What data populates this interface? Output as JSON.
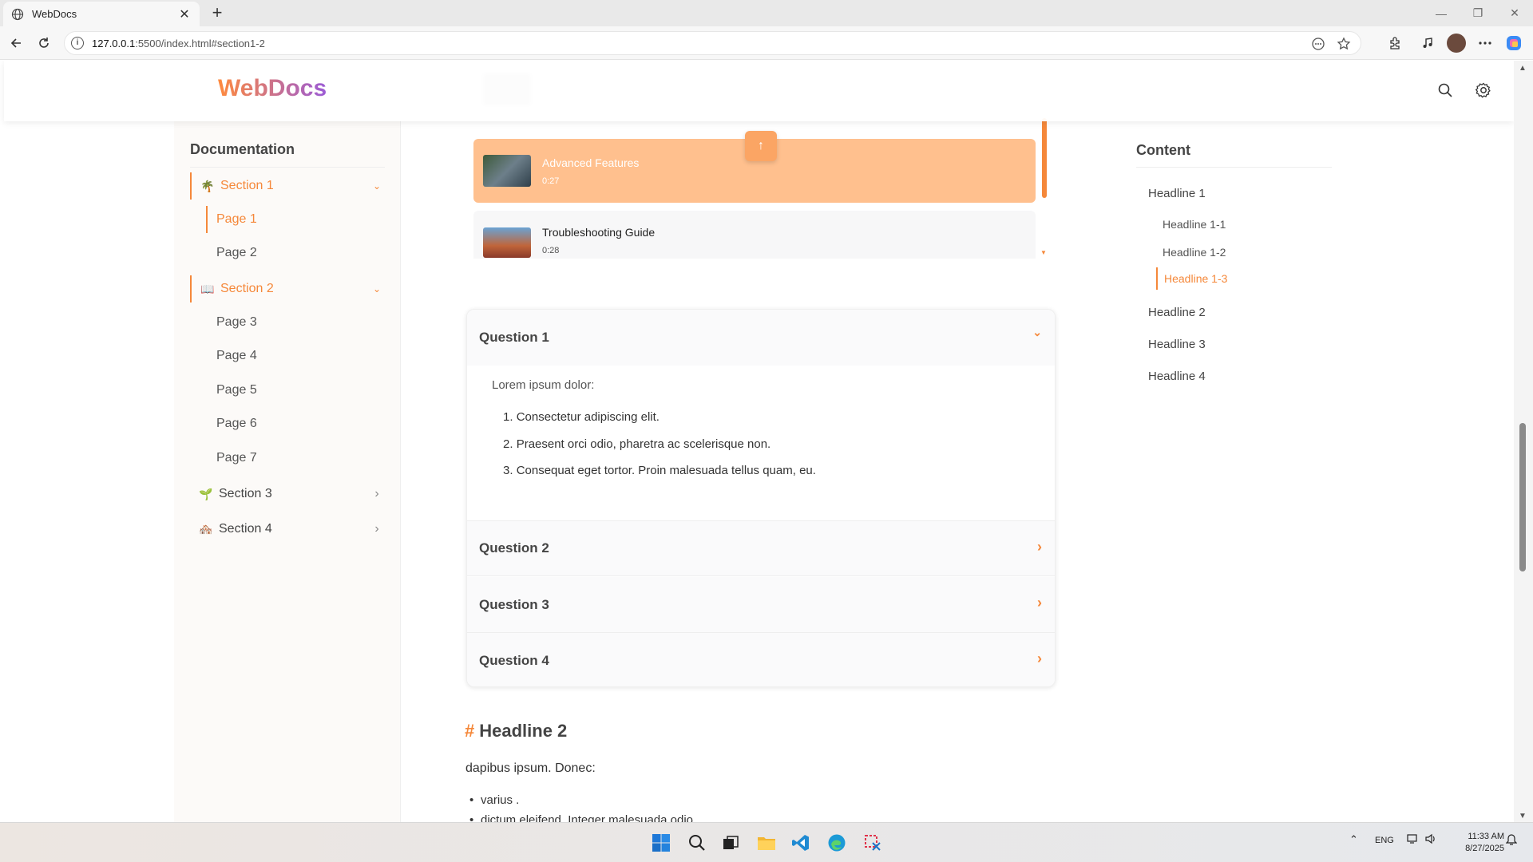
{
  "browser": {
    "tab_title": "WebDocs",
    "new_tab": "+",
    "url_host": "127.0.0.1",
    "url_rest": ":5500/index.html#section1-2",
    "minimize": "—",
    "restore": "❐",
    "close": "✕"
  },
  "site": {
    "logo": "WebDocs",
    "colors": {
      "accent": "#f5883a",
      "active_bg": "#ffc08e",
      "logo_from": "#ff8a3d",
      "logo_to": "#9b5bd6"
    }
  },
  "sidebar": {
    "title": "Documentation",
    "sections": [
      {
        "emoji": "🌴",
        "label": "Section 1",
        "chevron": "⌄"
      },
      {
        "emoji": "📖",
        "label": "Section 2",
        "chevron": "⌄"
      },
      {
        "emoji": "🌱",
        "label": "Section 3",
        "chevron": "›"
      },
      {
        "emoji": "🏘️",
        "label": "Section 4",
        "chevron": "›"
      }
    ],
    "pages": [
      "Page 1",
      "Page 2",
      "Page 3",
      "Page 4",
      "Page 5",
      "Page 6",
      "Page 7"
    ]
  },
  "playlist": {
    "items": [
      {
        "title": "Advanced Features",
        "duration": "0:27"
      },
      {
        "title": "Troubleshooting Guide",
        "duration": "0:28"
      }
    ],
    "to_top": "↑"
  },
  "faq": {
    "questions": [
      "Question 1",
      "Question 2",
      "Question 3",
      "Question 4"
    ],
    "open_chevron": "⌄",
    "closed_chevron": "›",
    "intro": "Lorem ipsum dolor:",
    "list": [
      "Consectetur adipiscing elit.",
      "Praesent orci odio, pharetra ac scelerisque non.",
      "Consequat eget tortor. Proin malesuada tellus quam, eu."
    ],
    "list_numbers": [
      "1.",
      "2.",
      "3."
    ]
  },
  "article": {
    "hash": "#",
    "headline": "Headline 2",
    "paragraph": "dapibus ipsum. Donec:",
    "bullets": [
      "varius .",
      "dictum eleifend. Integer malesuada odio"
    ]
  },
  "toc": {
    "title": "Content",
    "items": [
      "Headline 1",
      "Headline 1-1",
      "Headline 1-2",
      "Headline 1-3",
      "Headline 2",
      "Headline 3",
      "Headline 4"
    ]
  },
  "taskbar": {
    "lang": "ENG",
    "time": "11:33 AM",
    "date": "8/27/2025"
  }
}
